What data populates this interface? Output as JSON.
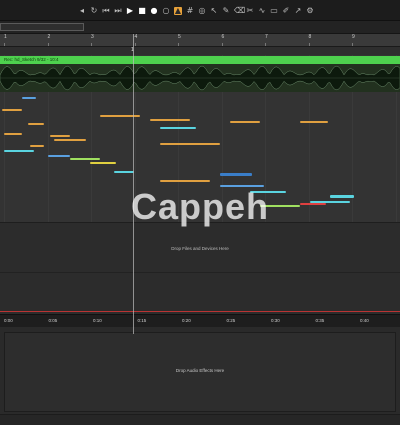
{
  "toolbar": {
    "icons": [
      "rewind-icon",
      "loop-icon",
      "skip-back-icon",
      "skip-forward-icon",
      "play-icon",
      "stop-icon",
      "record-icon",
      "punch-icon",
      "metronome-icon",
      "grid-icon",
      "snap-icon",
      "tool-select-icon",
      "tool-draw-icon",
      "tool-erase-icon",
      "tool-cut-icon",
      "tool-curve-icon",
      "tool-screen-icon",
      "tool-pen-icon",
      "tool-link-icon",
      "tool-plugin-icon"
    ]
  },
  "ruler": {
    "ticks": [
      "1",
      "2",
      "3",
      "4",
      "5",
      "6",
      "7",
      "8",
      "9"
    ]
  },
  "locator": {
    "marker": "1"
  },
  "arrangement": {
    "clip_title": "Rec: hd_Sketch 9/32 - 10:4",
    "notes": [
      {
        "c": "#5aa0e0"
      },
      {
        "c": "#e0a040"
      },
      {
        "c": "#e0a040"
      },
      {
        "c": "#e0a040"
      },
      {
        "c": "#e0a040"
      },
      {
        "c": "#e0a040"
      },
      {
        "c": "#e0a040"
      },
      {
        "c": "#e0a040"
      },
      {
        "c": "#5ad4e0"
      },
      {
        "c": "#e0a040"
      },
      {
        "c": "#e0a040"
      },
      {
        "c": "#e0a040"
      },
      {
        "c": "#5ad4e0"
      },
      {
        "c": "#5aa0e0"
      },
      {
        "c": "#a0e060"
      },
      {
        "c": "#e0d040"
      },
      {
        "c": "#5ad4e0"
      },
      {
        "c": "#e0a040"
      },
      {
        "c": "#5aa0e0"
      },
      {
        "c": "#5ad4e0"
      },
      {
        "c": "#a0e060"
      },
      {
        "c": "#e04040"
      },
      {
        "c": "#5ad4e0"
      },
      {
        "c": "#e0a040"
      }
    ]
  },
  "dropzone": {
    "text": "Drop Files and Devices Here"
  },
  "timebar": {
    "ticks": [
      "0:00",
      "0:05",
      "0:10",
      "0:15",
      "0:20",
      "0:25",
      "0:30",
      "0:35",
      "0:40"
    ]
  },
  "fx": {
    "text": "Drop Audio Effects Here"
  },
  "watermark": {
    "text": "Cappeh"
  },
  "colors": {
    "clip": "#4ed14e",
    "playhead": "#bdbdbd",
    "loop_line": "#b33333",
    "accent": "#e8a23a"
  }
}
